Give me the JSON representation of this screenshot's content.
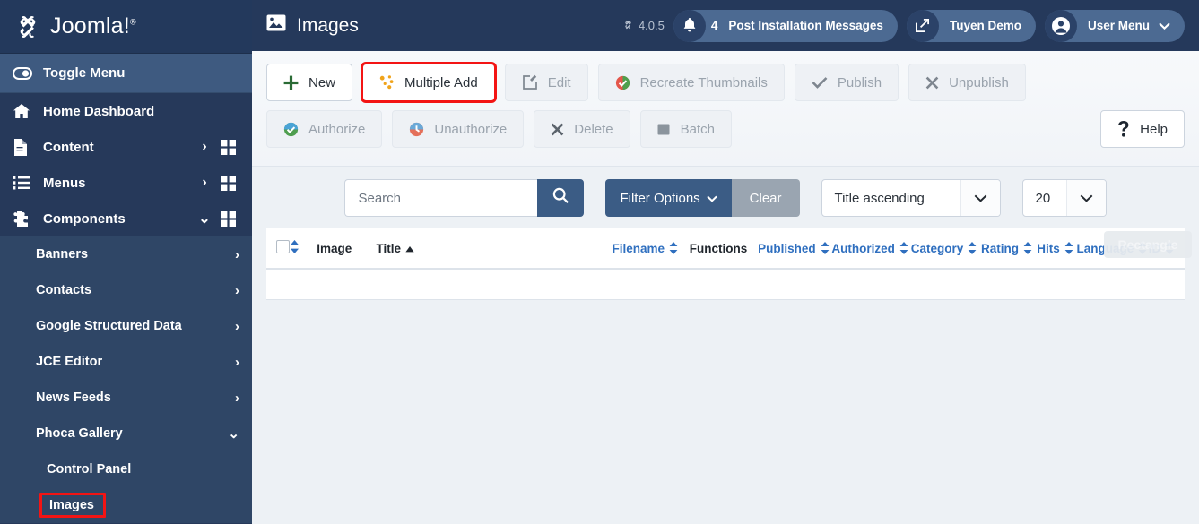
{
  "brand": {
    "name": "Joomla!",
    "icon": "joomla-logo-icon"
  },
  "sidebar": {
    "toggle": {
      "label": "Toggle Menu",
      "icon": "toggle-icon"
    },
    "items": [
      {
        "label": "Home Dashboard",
        "icon": "home-icon",
        "chevron": "",
        "grid": false
      },
      {
        "label": "Content",
        "icon": "document-icon",
        "chevron": "›",
        "grid": true
      },
      {
        "label": "Menus",
        "icon": "list-icon",
        "chevron": "›",
        "grid": true
      },
      {
        "label": "Components",
        "icon": "puzzle-icon",
        "chevron": "⌄",
        "grid": true
      }
    ],
    "sub_items": [
      {
        "label": "Banners",
        "chevron": "›"
      },
      {
        "label": "Contacts",
        "chevron": "›"
      },
      {
        "label": "Google Structured Data",
        "chevron": "›"
      },
      {
        "label": "JCE Editor",
        "chevron": "›"
      },
      {
        "label": "News Feeds",
        "chevron": "›"
      },
      {
        "label": "Phoca Gallery",
        "chevron": "⌄"
      }
    ],
    "phoca_children": [
      {
        "label": "Control Panel",
        "highlighted": false
      },
      {
        "label": "Images",
        "highlighted": true
      }
    ]
  },
  "header": {
    "title": "Images",
    "title_icon": "image-icon",
    "version": "4.0.5",
    "version_icon": "joomla-mark-icon",
    "messages": {
      "count": "4",
      "label": "Post Installation Messages",
      "icon": "bell-icon"
    },
    "site": {
      "label": "Tuyen Demo",
      "icon": "external-link-icon"
    },
    "user": {
      "label": "User Menu",
      "icon": "user-circle-icon",
      "chevron": "⌄"
    }
  },
  "toolbar": {
    "row1": [
      {
        "label": "New",
        "icon": "plus-icon",
        "state": "enabled",
        "highlighted": false
      },
      {
        "label": "Multiple Add",
        "icon": "multiple-add-icon",
        "state": "enabled",
        "highlighted": true
      },
      {
        "label": "Edit",
        "icon": "edit-pencil-icon",
        "state": "disabled",
        "highlighted": false
      },
      {
        "label": "Recreate Thumbnails",
        "icon": "recreate-thumbnails-icon",
        "state": "disabled",
        "highlighted": false
      },
      {
        "label": "Publish",
        "icon": "check-icon",
        "state": "disabled",
        "highlighted": false
      },
      {
        "label": "Unpublish",
        "icon": "x-icon",
        "state": "disabled",
        "highlighted": false
      }
    ],
    "row2": [
      {
        "label": "Authorize",
        "icon": "authorize-icon",
        "state": "disabled",
        "highlighted": false
      },
      {
        "label": "Unauthorize",
        "icon": "unauthorize-icon",
        "state": "disabled",
        "highlighted": false
      },
      {
        "label": "Delete",
        "icon": "x-icon",
        "state": "disabled",
        "highlighted": false
      },
      {
        "label": "Batch",
        "icon": "batch-square-icon",
        "state": "disabled",
        "highlighted": false
      }
    ],
    "help": {
      "label": "Help",
      "icon": "question-mark-icon"
    }
  },
  "filters": {
    "search_placeholder": "Search",
    "search_value": "",
    "search_icon": "magnifier-icon",
    "filter_options_label": "Filter Options",
    "clear_label": "Clear",
    "sort_value": "Title ascending",
    "limit_value": "20"
  },
  "table": {
    "columns": [
      {
        "label": "",
        "type": "checkbox",
        "link": false
      },
      {
        "label": "",
        "type": "ordering",
        "link": false
      },
      {
        "label": "Image",
        "type": "text",
        "link": false
      },
      {
        "label": "Title",
        "type": "sorted-asc",
        "link": false
      },
      {
        "label": "Filename",
        "type": "sortable",
        "link": true
      },
      {
        "label": "Functions",
        "type": "text",
        "link": false
      },
      {
        "label": "Published",
        "type": "sortable",
        "link": true
      },
      {
        "label": "Authorized",
        "type": "sortable",
        "link": true
      },
      {
        "label": "Category",
        "type": "sortable",
        "link": true
      },
      {
        "label": "Rating",
        "type": "sortable",
        "link": true
      },
      {
        "label": "Hits",
        "type": "sortable",
        "link": true
      },
      {
        "label": "Language",
        "type": "sortable",
        "link": true
      },
      {
        "label": "ID",
        "type": "sortable",
        "link": true
      }
    ],
    "rows": []
  },
  "overlay": {
    "rectangle_tooltip": "Rectangle"
  },
  "colors": {
    "sidebar": "#26395a",
    "sidebar_sub": "#2f4666",
    "topbar": "#25395b",
    "accent_blue": "#3b5c85",
    "link_blue": "#2f6fbf",
    "highlight_red": "#f31414",
    "page_bg": "#edf1f5"
  }
}
